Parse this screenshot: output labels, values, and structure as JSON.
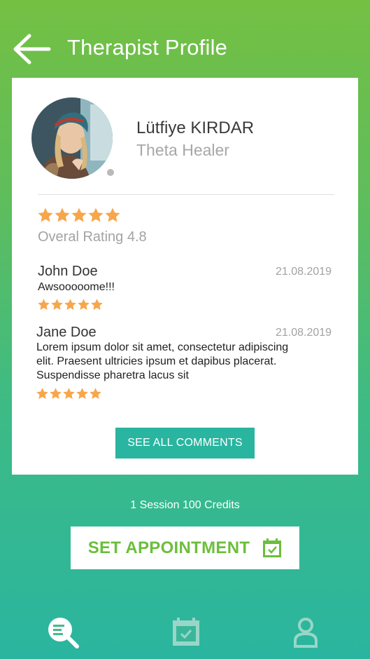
{
  "header": {
    "title": "Therapist Profile",
    "back_icon": "arrow-left-icon"
  },
  "profile": {
    "name": "Lütfiye KIRDAR",
    "role": "Theta Healer",
    "status_color": "#b9b9b9"
  },
  "rating": {
    "stars": 5,
    "label": "Overal Rating 4.8",
    "star_color": "#f7a64b"
  },
  "reviews": [
    {
      "name": "John Doe",
      "date": "21.08.2019",
      "text": "Awsooooome!!!",
      "stars": 5
    },
    {
      "name": "Jane Doe",
      "date": "21.08.2019",
      "text_lines": [
        "Lorem ipsum dolor sit amet, consectetur adipiscing",
        "elit. Praesent ultricies ipsum et dapibus placerat.",
        "Suspendisse pharetra lacus sit"
      ],
      "stars": 5
    }
  ],
  "see_all_label": "SEE ALL COMMENTS",
  "credits_text": "1 Session 100 Credits",
  "appointment_label": "SET APPOINTMENT",
  "colors": {
    "accent_green": "#6cbe3c",
    "teal": "#2ab5a0"
  },
  "tabs": [
    {
      "icon": "search-list-icon",
      "active": true
    },
    {
      "icon": "calendar-icon",
      "active": false
    },
    {
      "icon": "user-icon",
      "active": false
    }
  ]
}
